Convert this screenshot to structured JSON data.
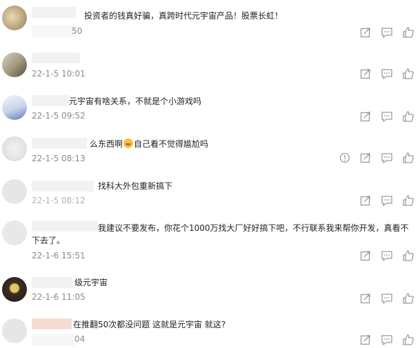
{
  "comments": [
    {
      "text": "投资者的钱真好骗，真跨时代元宇宙产品！股票长虹！",
      "time": "50"
    },
    {
      "text": "",
      "time": "22-1-5 10:01"
    },
    {
      "text": "元宇宙有啥关系，不就是个小游戏吗",
      "time": "22-1-5 09:52"
    },
    {
      "text_before": "么东西啊",
      "text_after": "自己看不觉得尴尬吗",
      "time": "22-1-5 08:13"
    },
    {
      "text": "找科大外包重新搞下",
      "time": "22-1-5 08:12"
    },
    {
      "text": "我建议不要发布，你花个1000万找大厂好好搞下吧，不行联系我来帮你开发，真看不下去了。",
      "time": "22-1-6 15:51"
    },
    {
      "text": "级元宇宙",
      "time": "22-1-6 11:05"
    },
    {
      "text": "在推翻50次都没问题 这就是元宇宙 就这?",
      "time": "04"
    }
  ],
  "colors": {
    "icon": "#9a9a9a",
    "time": "#8a8a8a",
    "text": "#222222"
  },
  "icons": [
    "share-icon",
    "comment-icon",
    "like-icon",
    "report-icon"
  ]
}
